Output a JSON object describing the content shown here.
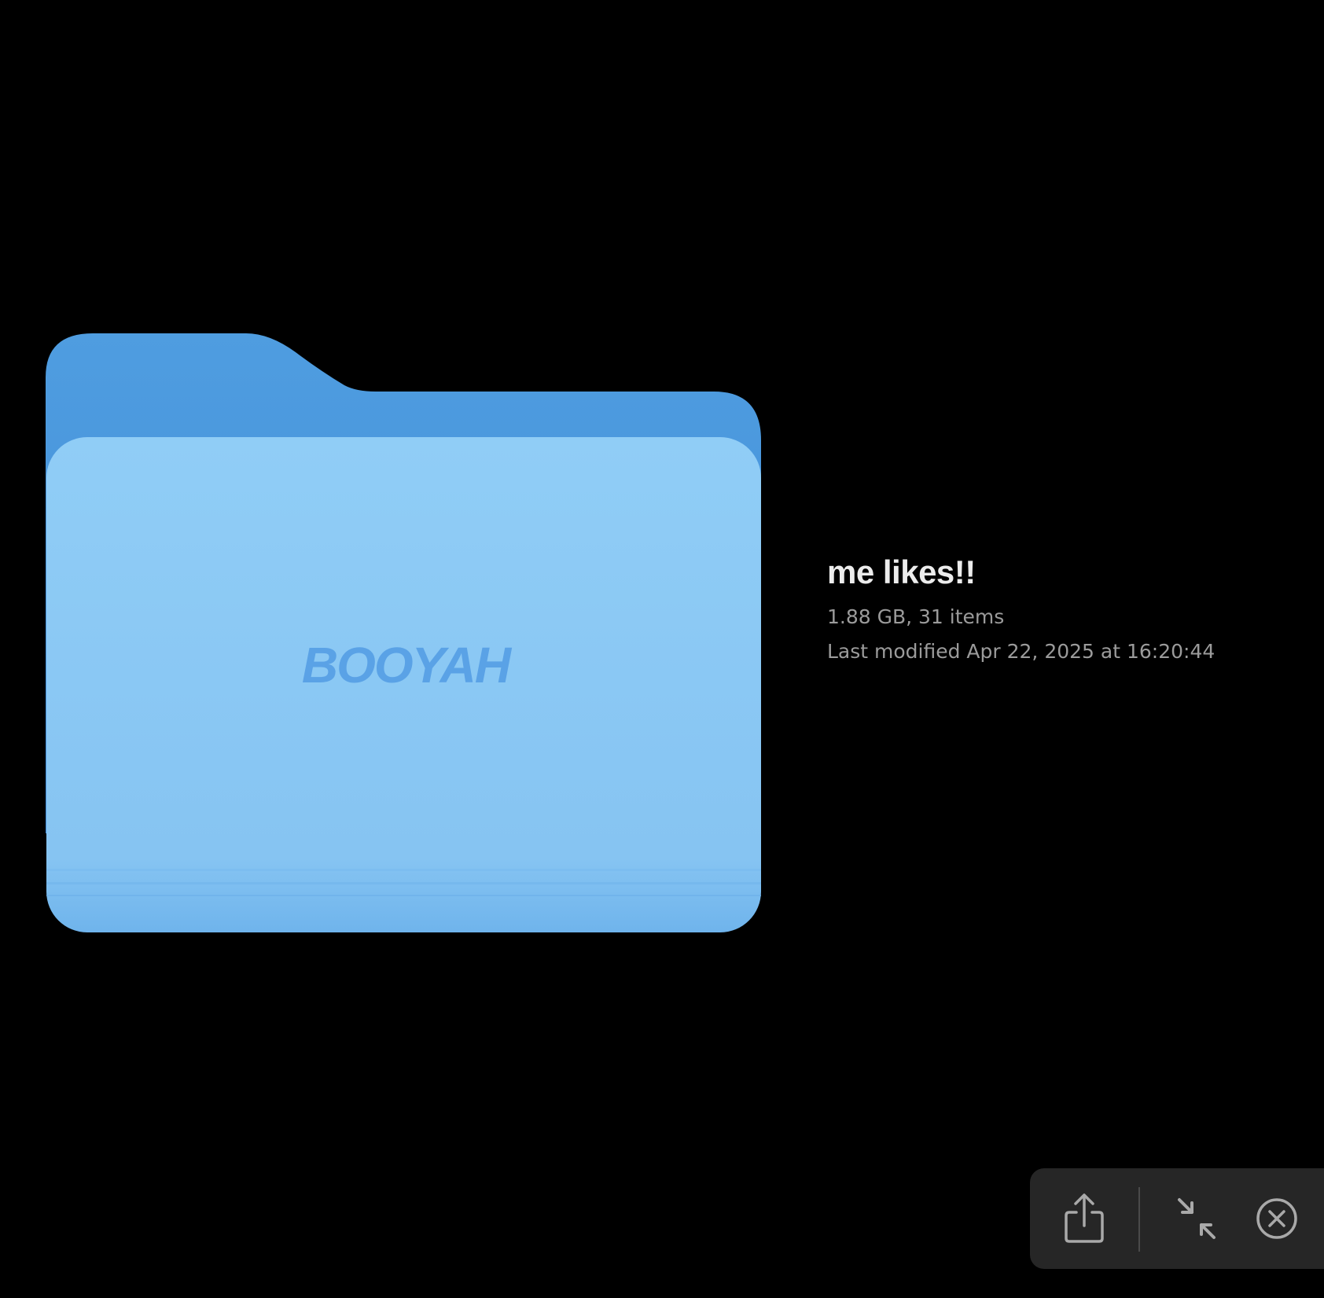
{
  "preview": {
    "folder_icon": {
      "icon": "folder-icon",
      "label": "BOOYAH",
      "colors": {
        "back": "#4d99dd",
        "front": "#8ecbf4",
        "label": "#5aa2e6"
      }
    },
    "info": {
      "name": "me likes!!",
      "size_items": "1.88 GB, 31 items",
      "modified": "Last modified Apr 22, 2025 at 16:20:44"
    }
  },
  "toolbar": {
    "share": {
      "icon": "share-icon"
    },
    "collapse": {
      "icon": "collapse-arrows-icon"
    },
    "close": {
      "icon": "close-circle-icon"
    }
  }
}
